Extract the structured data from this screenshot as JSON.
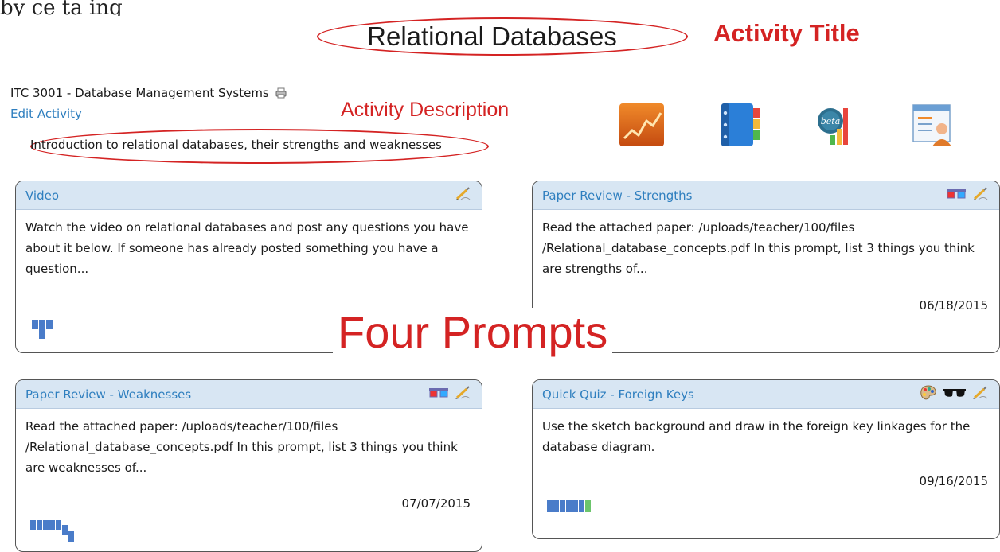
{
  "top_fragment": "by ce ta ing",
  "activity": {
    "title": "Relational Databases",
    "course": "ITC 3001 - Database Management Systems",
    "edit_label": "Edit Activity",
    "description": "Introduction to relational databases, their strengths and weaknesses"
  },
  "annotations": {
    "activity_title": "Activity Title",
    "activity_description": "Activity Description",
    "four_prompts": "Four Prompts"
  },
  "tools": [
    "analytics-icon",
    "notebook-icon",
    "beta-stats-icon",
    "roster-icon"
  ],
  "prompts": [
    {
      "title": "Video",
      "body": "Watch the video on relational databases and post any questions you have about it below.  If someone has already posted something you have a question...",
      "date": "",
      "icons": [
        "edit-icon"
      ]
    },
    {
      "title": "Paper Review - Strengths",
      "body": "Read the attached paper:  /uploads/teacher/100/files /Relational_database_concepts.pdf In this prompt, list 3 things you think are strengths of...",
      "date": "06/18/2015",
      "icons": [
        "3d-glasses-icon",
        "edit-icon"
      ]
    },
    {
      "title": "Paper Review - Weaknesses",
      "body": "Read the attached paper:  /uploads/teacher/100/files /Relational_database_concepts.pdf In this prompt, list 3 things you think are weaknesses of...",
      "date": "07/07/2015",
      "icons": [
        "3d-glasses-icon",
        "edit-icon"
      ]
    },
    {
      "title": "Quick Quiz - Foreign Keys",
      "body": "Use the sketch background and draw in the foreign key linkages for the database diagram.",
      "date": "09/16/2015",
      "icons": [
        "palette-icon",
        "sunglasses-icon",
        "edit-icon"
      ]
    }
  ],
  "colors": {
    "annotation_red": "#d42323",
    "link_blue": "#2f7fbf",
    "card_header": "#d8e6f3",
    "spark_blue": "#4a7cc9",
    "spark_green": "#6cc56c"
  }
}
